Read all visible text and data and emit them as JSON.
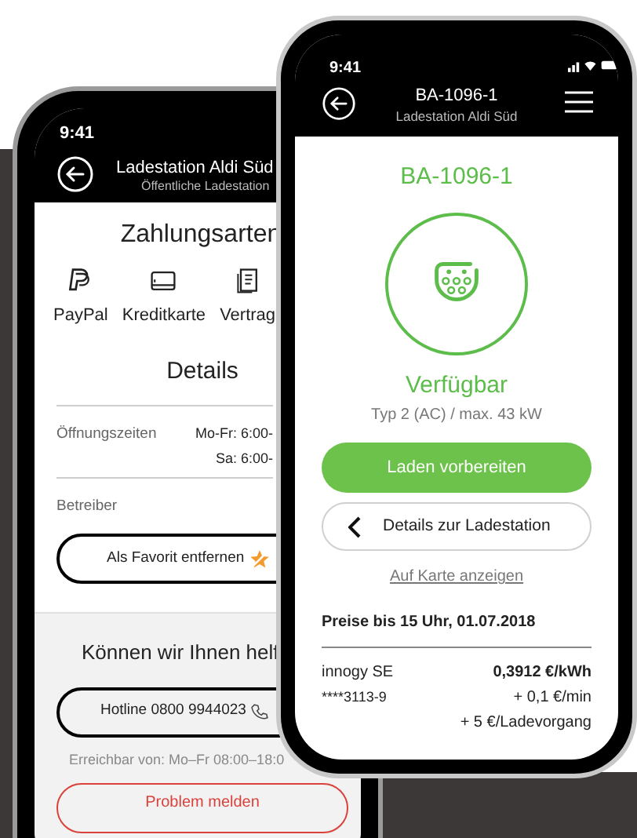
{
  "back_phone": {
    "status_bar": {
      "time": "9:41"
    },
    "header": {
      "title": "Ladestation Aldi Süd",
      "subtitle": "Öffentliche Ladestation"
    },
    "payment": {
      "title": "Zahlungsarten",
      "methods": [
        {
          "kind": "paypal",
          "label": "PayPal"
        },
        {
          "kind": "card",
          "label": "Kreditkarte"
        },
        {
          "kind": "contract",
          "label": "Vertrag"
        }
      ]
    },
    "details": {
      "title": "Details",
      "rows": [
        {
          "label": "Öffnungszeiten",
          "values": [
            "Mo-Fr: 6:00-",
            "Sa: 6:00-"
          ]
        },
        {
          "label": "Betreiber",
          "values": []
        }
      ]
    },
    "favorite_button": "Als Favorit entfernen",
    "help": {
      "title": "Können wir Ihnen helf",
      "hotline_button": "Hotline 0800 9944023",
      "hours": "Erreichbar von: Mo–Fr 08:00–18:0",
      "report_button": "Problem melden"
    }
  },
  "front_phone": {
    "status_bar": {
      "time": "9:41"
    },
    "header": {
      "title": "BA-1096-1",
      "subtitle": "Ladestation Aldi Süd"
    },
    "station_id": "BA-1096-1",
    "status": "Verfügbar",
    "connector": "Typ 2 (AC) / max. 43 kW",
    "primary_button": "Laden vorbereiten",
    "details_button": "Details zur Ladestation",
    "map_link": "Auf Karte anzeigen",
    "prices": {
      "title": "Preise bis 15 Uhr, 01.07.2018",
      "provider": "innogy SE",
      "card": "****3113-9",
      "lines": [
        "0,3912 €/kWh",
        "+ 0,1 €/min",
        "+ 5 €/Ladevorgang"
      ]
    }
  }
}
